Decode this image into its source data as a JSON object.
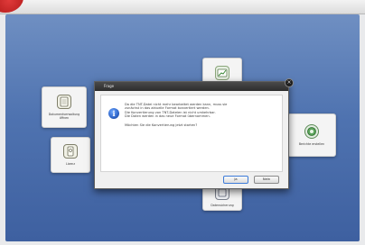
{
  "dialog": {
    "title": "Frage",
    "message_lines": [
      "Da die TNT-Datei nicht mehr bearbeitet werden kann, muss sie",
      "zunächst in das aktuelle Format konvertiert werden.",
      "Die Konvertierung von TNT-Dateien ist nicht umkehrbar.",
      "Die Daten werden in das neue Format übernommen."
    ],
    "question": "Möchten Sie die Konvertierung jetzt starten?",
    "ok_label": "Ja",
    "cancel_label": "Nein"
  },
  "tiles": {
    "left_top_label": "Dokumentverwaltung öffnen",
    "left_bottom_label": "Lizenz",
    "right_label": "Berichte erstellen",
    "bottom_label": "Datensicherung"
  },
  "icons": {
    "badge": "app-badge-icon",
    "info": "info-icon",
    "document": "document-icon",
    "license": "license-icon",
    "chart": "chart-icon",
    "backup": "backup-icon",
    "close": "close-icon"
  },
  "colors": {
    "desktop_top": "#6f8fc2",
    "desktop_bottom": "#3e60a0",
    "titlebar": "#2c2c2c",
    "info_blue": "#2d64c8",
    "badge_red": "#c62828"
  }
}
